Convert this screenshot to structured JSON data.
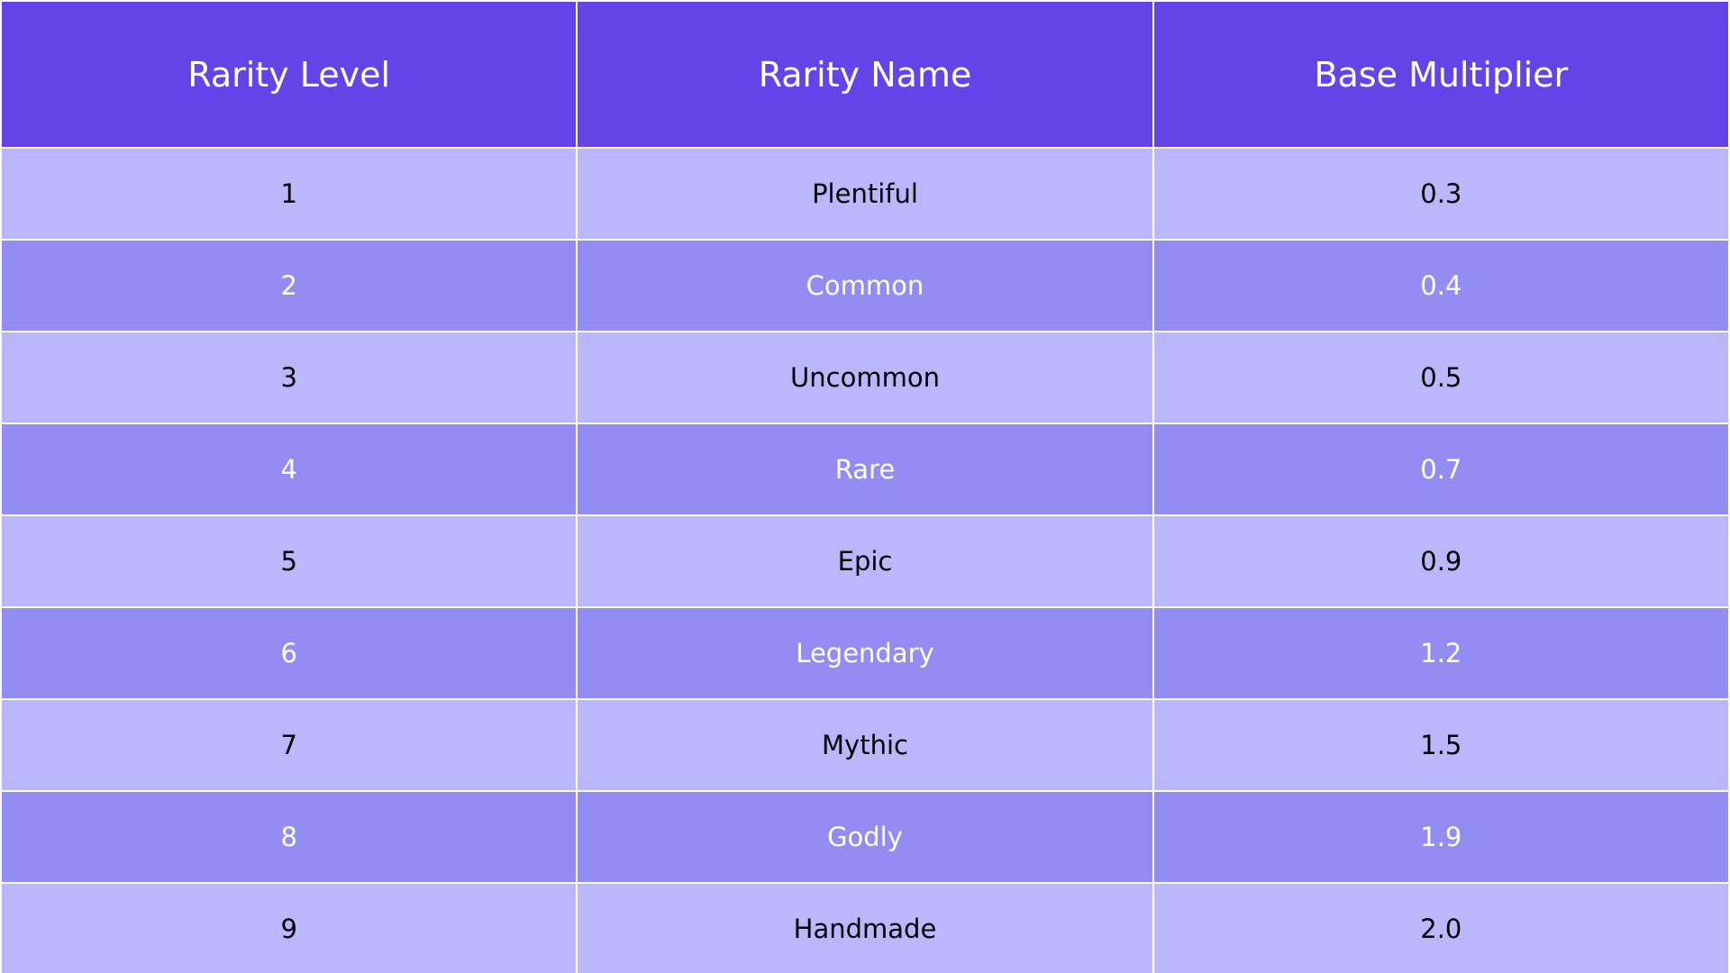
{
  "table": {
    "headers": [
      "Rarity Level",
      "Rarity Name",
      "Base Multiplier"
    ],
    "rows": [
      [
        "1",
        "Plentiful",
        "0.3"
      ],
      [
        "2",
        "Common",
        "0.4"
      ],
      [
        "3",
        "Uncommon",
        "0.5"
      ],
      [
        "4",
        "Rare",
        "0.7"
      ],
      [
        "5",
        "Epic",
        "0.9"
      ],
      [
        "6",
        "Legendary",
        "1.2"
      ],
      [
        "7",
        "Mythic",
        "1.5"
      ],
      [
        "8",
        "Godly",
        "1.9"
      ],
      [
        "9",
        "Handmade",
        "2.0"
      ]
    ]
  },
  "colors": {
    "header_bg": "#6344e7",
    "row_light_bg": "#bbb7fd",
    "row_dark_bg": "#938cf3",
    "grid_line": "#ffffff"
  }
}
